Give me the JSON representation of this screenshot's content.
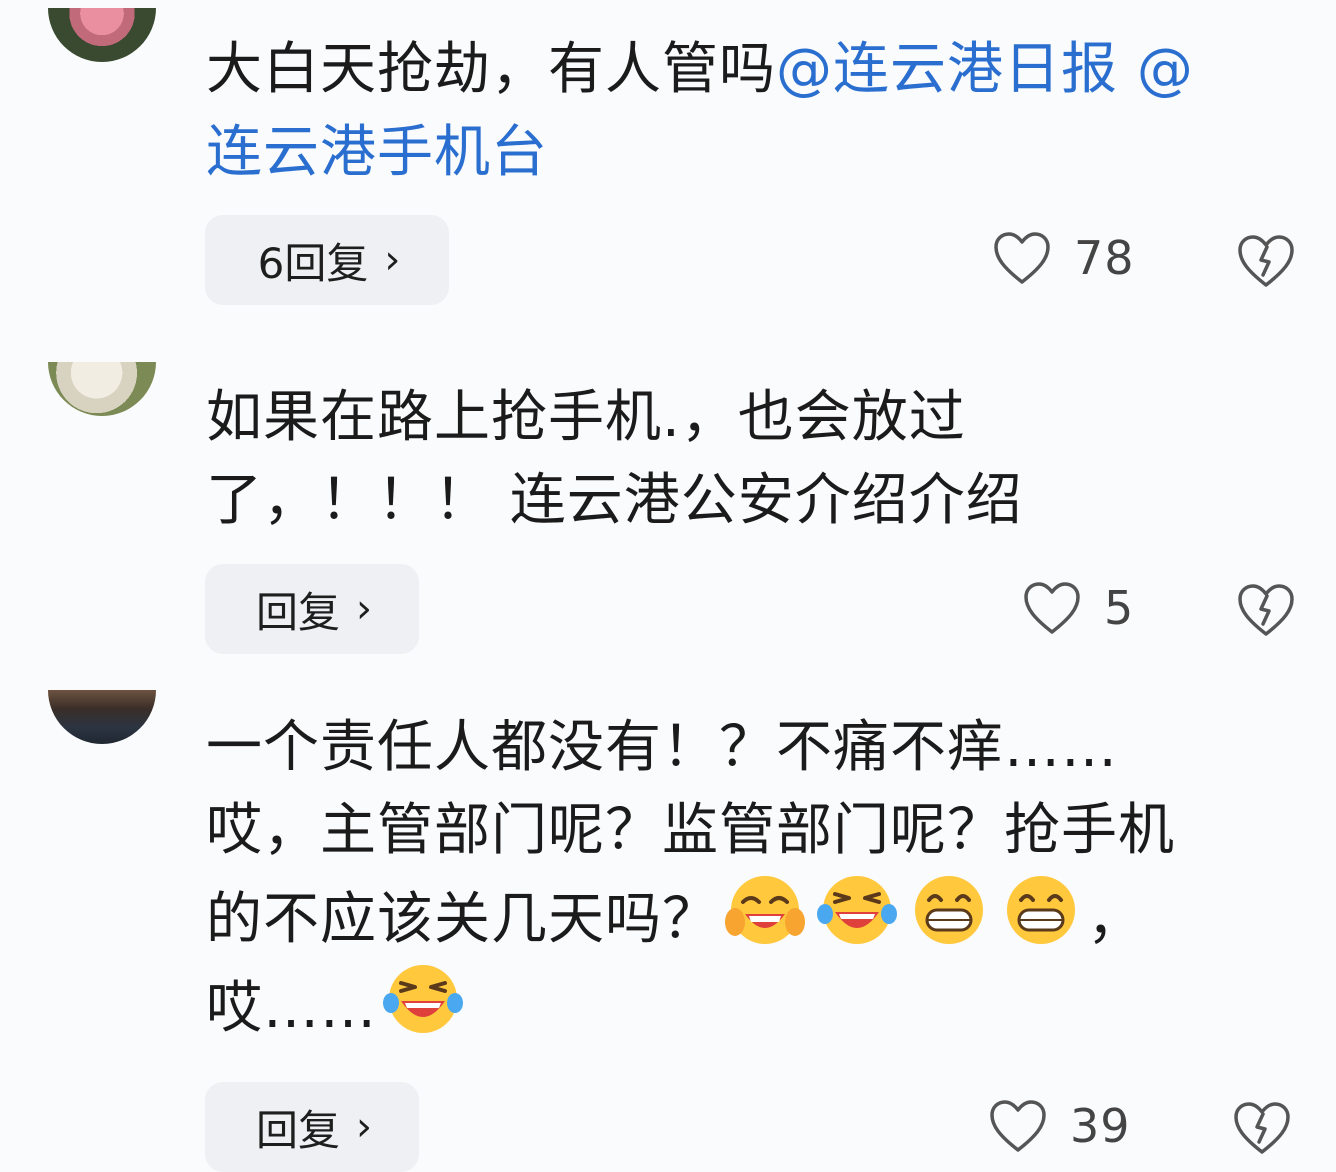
{
  "comments": [
    {
      "text": "大白天抢劫，有人管吗",
      "mention_1": "@连云港日报",
      "mention_2": "@\n连云港手机台",
      "reply_label": "6回复",
      "likes": "78"
    },
    {
      "text": "如果在路上抢手机.，也会放过\n了，！！！ 连云港公安介绍介绍",
      "reply_label": "回复",
      "likes": "5"
    },
    {
      "text_1": "一个责任人都没有！？不痛不痒……\n哎，主管部门呢？监管部门呢？抢手机\n的不应该关几天吗？",
      "text_2": "，\n哎……",
      "reply_label": "回复",
      "likes": "39"
    }
  ],
  "icons": {
    "like": "heart-outline-icon",
    "dislike": "broken-heart-icon",
    "chevron": "chevron-right-icon",
    "emoji_grin_tears": "grinning-tears-emoji",
    "emoji_laugh_tears": "laughing-tears-emoji",
    "emoji_grin": "grinning-face-emoji"
  },
  "colors": {
    "mention": "#2a6fd0",
    "background": "#fafbfc",
    "reply_button": "#eef0f3"
  }
}
